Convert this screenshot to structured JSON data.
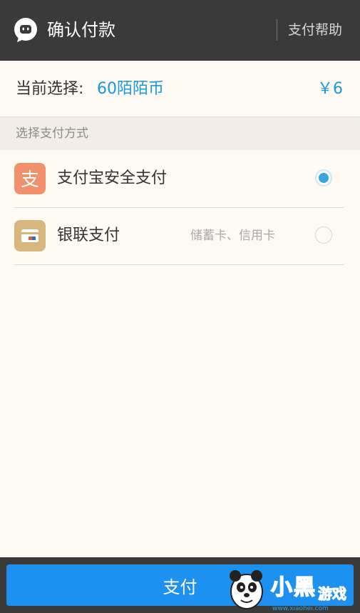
{
  "header": {
    "title": "确认付款",
    "help_label": "支付帮助"
  },
  "selection": {
    "label": "当前选择:",
    "item": "60陌陌币",
    "price": "￥6"
  },
  "section": {
    "title": "选择支付方式"
  },
  "payment_methods": [
    {
      "name": "支付宝安全支付",
      "sub": "",
      "selected": true,
      "icon": "alipay-icon",
      "icon_color": "#f0916b"
    },
    {
      "name": "银联支付",
      "sub": "储蓄卡、信用卡",
      "selected": false,
      "icon": "unionpay-card-icon",
      "icon_color": "#d8b77f"
    }
  ],
  "footer": {
    "pay_label": "支付"
  },
  "watermark": {
    "brand": "小黑游戏",
    "url": "www.xiaohei.com"
  },
  "colors": {
    "accent": "#1d97da",
    "pay_button": "#1e90f0",
    "bar": "#3a3a3a"
  }
}
